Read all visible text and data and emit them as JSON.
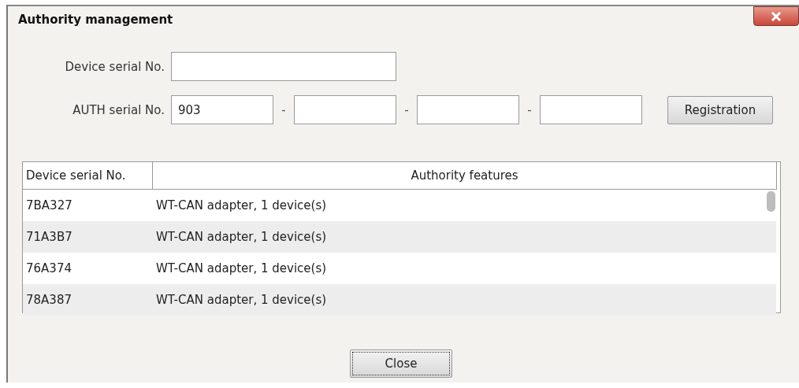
{
  "window": {
    "title": "Authority management"
  },
  "device_serial": {
    "label": "Device serial No."
  },
  "auth_serial": {
    "label": "AUTH serial No.",
    "first_part": "903",
    "separator": "-"
  },
  "register_button": {
    "label": "Registration"
  },
  "table": {
    "columns": [
      "Device serial No.",
      "Authority features"
    ],
    "rows": [
      {
        "serial": "7BA327",
        "features": "WT-CAN adapter, 1 device(s)"
      },
      {
        "serial": "71A3B7",
        "features": "WT-CAN adapter, 1 device(s)"
      },
      {
        "serial": "76A374",
        "features": "WT-CAN adapter, 1 device(s)"
      },
      {
        "serial": "78A387",
        "features": "WT-CAN adapter, 1 device(s)"
      }
    ]
  },
  "close_button": {
    "label": "Close",
    "focused": true
  }
}
